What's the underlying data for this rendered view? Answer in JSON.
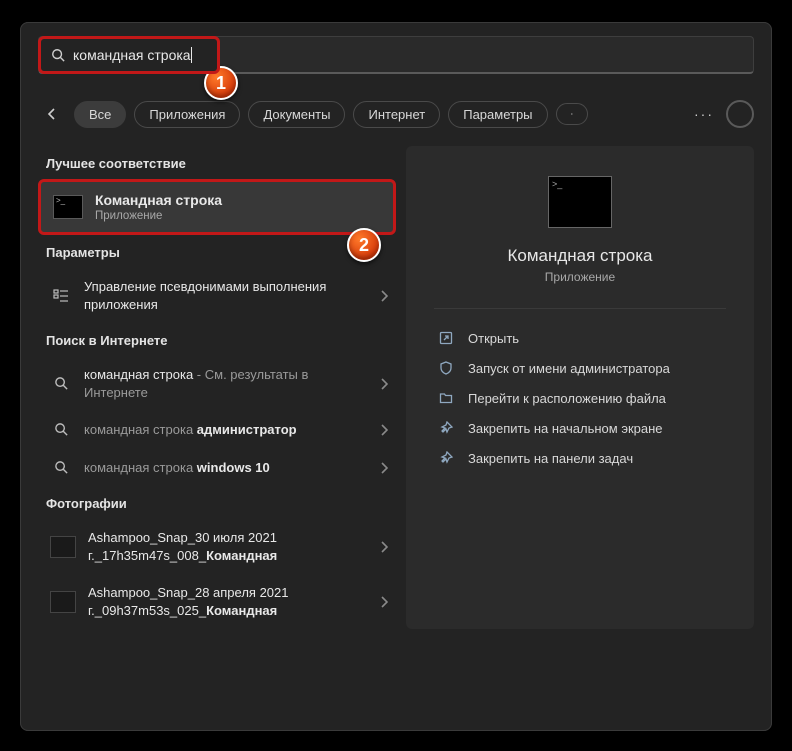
{
  "search": {
    "value": "командная строка"
  },
  "filters": {
    "all": "Все",
    "apps": "Приложения",
    "docs": "Документы",
    "web": "Интернет",
    "settings": "Параметры"
  },
  "sections": {
    "best": "Лучшее соответствие",
    "params": "Параметры",
    "websearch": "Поиск в Интернете",
    "photos": "Фотографии"
  },
  "bestMatch": {
    "title": "Командная строка",
    "sub": "Приложение"
  },
  "params_row": "Управление псевдонимами выполнения приложения",
  "web": {
    "r1a": "командная строка",
    "r1b": " - См. результаты в Интернете",
    "r2a": "командная строка ",
    "r2b": "администратор",
    "r3a": "командная строка ",
    "r3b": "windows 10"
  },
  "photos": {
    "p1a": "Ashampoo_Snap_30 июля 2021 г._17h35m47s_008_",
    "p1b": "Командная",
    "p2a": "Ashampoo_Snap_28 апреля 2021 г._09h37m53s_025_",
    "p2b": "Командная"
  },
  "preview": {
    "title": "Командная строка",
    "sub": "Приложение"
  },
  "actions": {
    "open": "Открыть",
    "admin": "Запуск от имени администратора",
    "loc": "Перейти к расположению файла",
    "pinStart": "Закрепить на начальном экране",
    "pinTask": "Закрепить на панели задач"
  },
  "badges": {
    "b1": "1",
    "b2": "2"
  }
}
